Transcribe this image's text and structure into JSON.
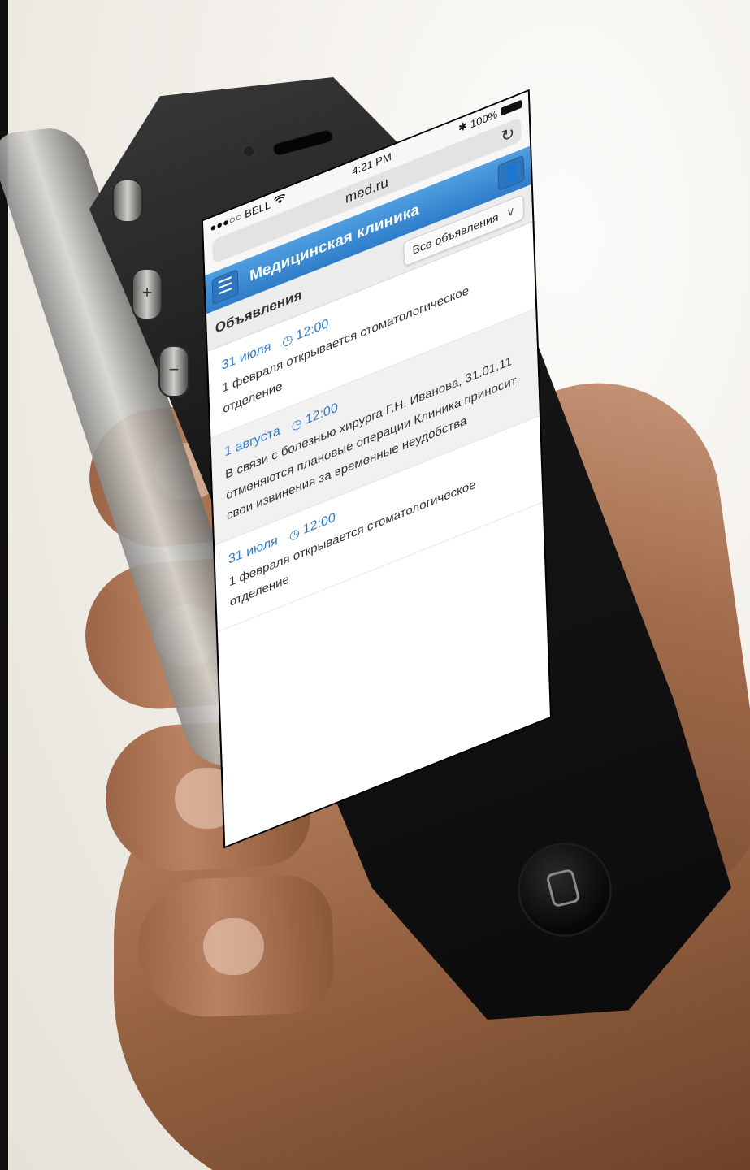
{
  "status_bar": {
    "carrier": "●●●○○ BELL",
    "wifi_icon": "wifi-icon",
    "time": "4:21 PM",
    "battery_text": "100%"
  },
  "browser": {
    "url": "med.ru",
    "reload_icon": "reload-icon"
  },
  "app_bar": {
    "title": "Медицинская клиника",
    "color": "#3b8cd8"
  },
  "section": {
    "title": "Объявления",
    "filter_value": "Все объявления"
  },
  "announcements": [
    {
      "date": "31 июля",
      "time": "12:00",
      "text": "1 февраля открывается стоматологическое отделение"
    },
    {
      "date": "1 августа",
      "time": "12:00",
      "text": "В связи с болезнью хирурга Г.Н. Иванова, 31.01.11 отменяются плановые операции Клиника приносит свои извинения за временные неудобства"
    },
    {
      "date": "31 июля",
      "time": "12:00",
      "text": "1 февраля открывается стоматологическое отделение"
    }
  ],
  "edge_mark": "›"
}
